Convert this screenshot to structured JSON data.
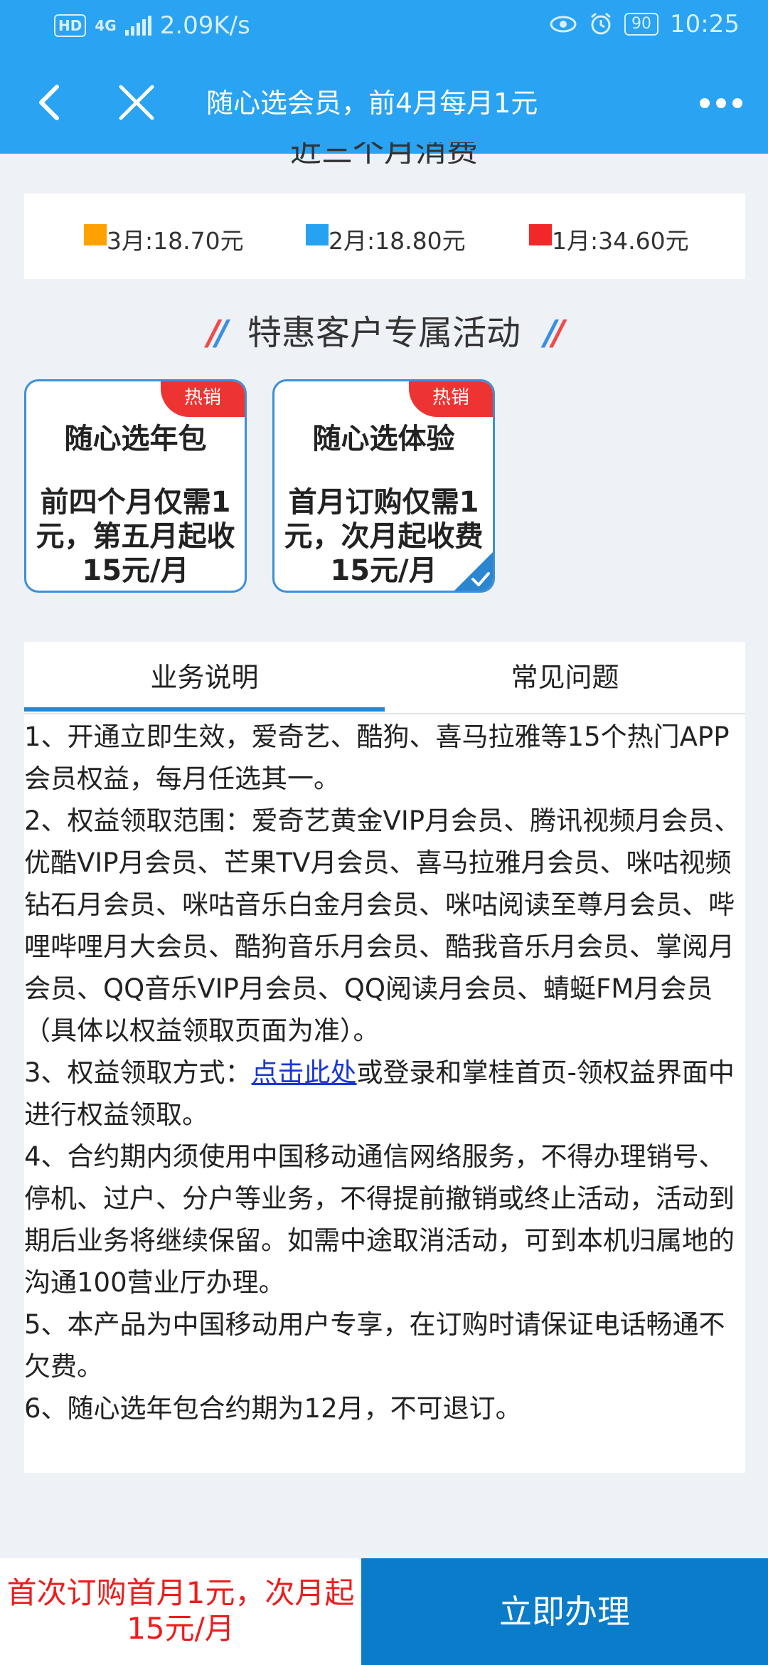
{
  "status_bar": {
    "hd_badge": "HD",
    "network": "4G",
    "speed": "2.09K/s",
    "battery": "90",
    "time": "10:25"
  },
  "nav": {
    "title": "随心选会员，前4月每月1元"
  },
  "partial_heading": "近三个月消费",
  "legend": [
    {
      "label": "3月:18.70元",
      "color": "#ffa100"
    },
    {
      "label": "2月:18.80元",
      "color": "#25a3f0"
    },
    {
      "label": "1月:34.60元",
      "color": "#f22828"
    }
  ],
  "section_title": "特惠客户专属活动",
  "cards": [
    {
      "tag": "热销",
      "title": "随心选年包",
      "desc": "前四个月仅需1元，第五月起收15元/月"
    },
    {
      "tag": "热销",
      "title": "随心选体验",
      "desc": "首月订购仅需1元，次月起收费15元/月"
    }
  ],
  "tabs": [
    {
      "label": "业务说明"
    },
    {
      "label": "常见问题"
    }
  ],
  "description": {
    "p1": "1、开通立即生效，爱奇艺、酷狗、喜马拉雅等15个热门APP会员权益，每月任选其一。",
    "p2": "2、权益领取范围：爱奇艺黄金VIP月会员、腾讯视频月会员、优酷VIP月会员、芒果TV月会员、喜马拉雅月会员、咪咕视频钻石月会员、咪咕音乐白金月会员、咪咕阅读至尊月会员、哔哩哔哩月大会员、酷狗音乐月会员、酷我音乐月会员、掌阅月会员、QQ音乐VIP月会员、QQ阅读月会员、蜻蜓FM月会员（具体以权益领取页面为准）。",
    "p3_prefix": "3、权益领取方式：",
    "p3_link": "点击此处",
    "p3_suffix": "或登录和掌桂首页-领权益界面中进行权益领取。",
    "p4": "4、合约期内须使用中国移动通信网络服务，不得办理销号、停机、过户、分户等业务，不得提前撤销或终止活动，活动到期后业务将继续保留。如需中途取消活动，可到本机归属地的沟通100营业厅办理。",
    "p5": "5、本产品为中国移动用户专享，在订购时请保证电话畅通不欠费。",
    "p6": "6、随心选年包合约期为12月，不可退订。"
  },
  "bottom": {
    "promo": "首次订购首月1元，次月起15元/月",
    "cta_label": "立即办理"
  }
}
